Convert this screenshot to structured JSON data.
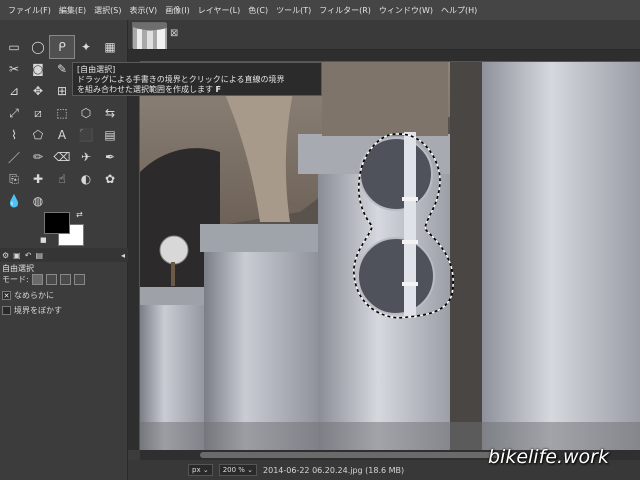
{
  "menubar": [
    "ファイル(F)",
    "編集(E)",
    "選択(S)",
    "表示(V)",
    "画像(I)",
    "レイヤー(L)",
    "色(C)",
    "ツール(T)",
    "フィルター(R)",
    "ウィンドウ(W)",
    "ヘルプ(H)"
  ],
  "tabstrip": {
    "close": "⊠"
  },
  "tooltip": {
    "title": "[自由選択]",
    "line1": "ドラッグによる手書きの境界とクリックによる直線の境界",
    "line2": "を組み合わせた選択範囲を作成します",
    "shortcut": "F"
  },
  "tool_options": {
    "title": "自由選択",
    "mode_label": "モード:",
    "antialias_label": "なめらかに",
    "feather_label": "境界をぼかす"
  },
  "statusbar": {
    "unit": "px",
    "zoom": "200 %",
    "file_info": "2014-06-22 06.20.24.jpg (18.6 MB)"
  },
  "watermark": "bikelife.work",
  "icons": {
    "rect-select": "▭",
    "ellipse-select": "◯",
    "lasso": "ᑭ",
    "fuzzy-select": "✦",
    "select-by-color": "▦",
    "scissors": "✂",
    "foreground-select": "◙",
    "paths": "✎",
    "color-picker": "⌀",
    "zoom": "⚲",
    "measure": "⊿",
    "move": "✥",
    "align": "⊞",
    "crop": "⌗",
    "rotate": "⟳",
    "scale": "⤢",
    "shear": "⧄",
    "perspective": "⬚",
    "3d-transform": "⬡",
    "flip": "⇆",
    "warp": "⌇",
    "cage": "⬠",
    "text": "A",
    "bucket": "⬛",
    "gradient": "▤",
    "paintbrush": "／",
    "pencil": "✏",
    "eraser": "⌫",
    "airbrush": "✈",
    "ink": "✒",
    "clone": "⎘",
    "heal": "✚",
    "smudge": "☝",
    "dodge": "◐",
    "blur": "💧",
    "mypaint": "✿",
    "convolve": "◍",
    "fg-bg": "⇄"
  }
}
